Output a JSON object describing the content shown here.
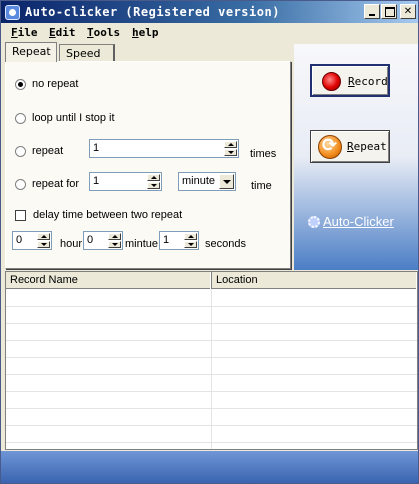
{
  "window": {
    "title": "Auto-clicker (Registered version)"
  },
  "menu": {
    "file": "File",
    "edit": "Edit",
    "tools": "Tools",
    "help": "help"
  },
  "tabs": {
    "repeat": "Repeat",
    "speed": "Speed"
  },
  "options": {
    "no_repeat": "no repeat",
    "loop": "loop until I stop it",
    "repeat": "repeat",
    "repeat_count": "1",
    "times": "times",
    "repeat_for": "repeat for",
    "repeat_for_value": "1",
    "unit": "minute",
    "time": "time",
    "delay_label": "delay time between two repeat",
    "hours": "0",
    "hour_label": "hour",
    "minutes": "0",
    "minute_label": "mintue",
    "seconds": "1",
    "seconds_label": "seconds"
  },
  "buttons": {
    "record": "Record",
    "repeat": "Repeat"
  },
  "link": "Auto-Clicker",
  "table": {
    "columns": [
      "Record Name",
      "Location"
    ]
  }
}
